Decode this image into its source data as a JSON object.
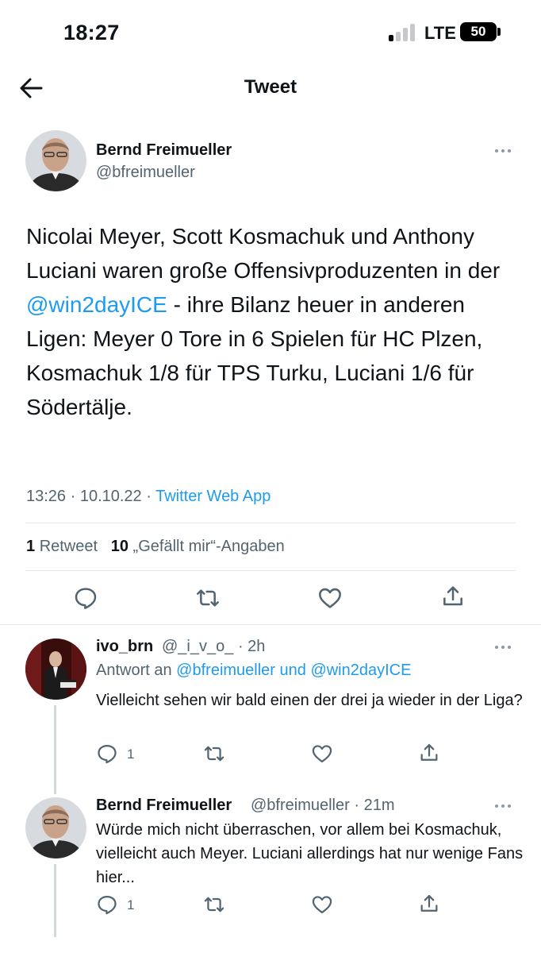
{
  "status_bar": {
    "time": "18:27",
    "network": "LTE",
    "battery": "50"
  },
  "header": {
    "title": "Tweet",
    "back_icon": "arrow-left-icon"
  },
  "main_tweet": {
    "author_name": "Bernd Freimueller",
    "author_handle": "@bfreimueller",
    "text_part1": "Nicolai Meyer, Scott Kosmachuk und Anthony Luciani waren große Offensivproduzenten in der ",
    "mention": "@win2dayICE",
    "text_part2": " - ihre Bilanz heuer in anderen Ligen: Meyer 0 Tore in 6 Spielen für HC Plzen, Kosmachuk 1/8 für TPS Turku, Luciani 1/6 für Södertälje.",
    "time_date": "13:26 · 10.10.22 · ",
    "source": "Twitter Web App",
    "retweet_count": "1",
    "retweet_label": "Retweet",
    "like_count": "10",
    "like_label": "„Gefällt mir“-Angaben"
  },
  "replies": [
    {
      "author_name": "ivo_brn",
      "author_handle": "@_i_v_o_",
      "time": "· 2h",
      "reply_to_label": "Antwort an ",
      "reply_to_users": "@bfreimueller und @win2dayICE",
      "text": "Vielleicht sehen wir bald einen der drei ja wieder in der Liga?",
      "reply_count": "1"
    },
    {
      "author_name": "Bernd Freimueller",
      "author_handle": "@bfreimueller",
      "time": "· 21m",
      "text": "Würde mich nicht überraschen, vor allem bei Kosmachuk, vielleicht auch Meyer. Luciani allerdings hat nur wenige Fans hier...",
      "reply_count": "1"
    }
  ],
  "colors": {
    "accent": "#1d9bf0",
    "secondary_text": "#536471",
    "icon": "#536471",
    "divider": "#e6e9ec"
  }
}
